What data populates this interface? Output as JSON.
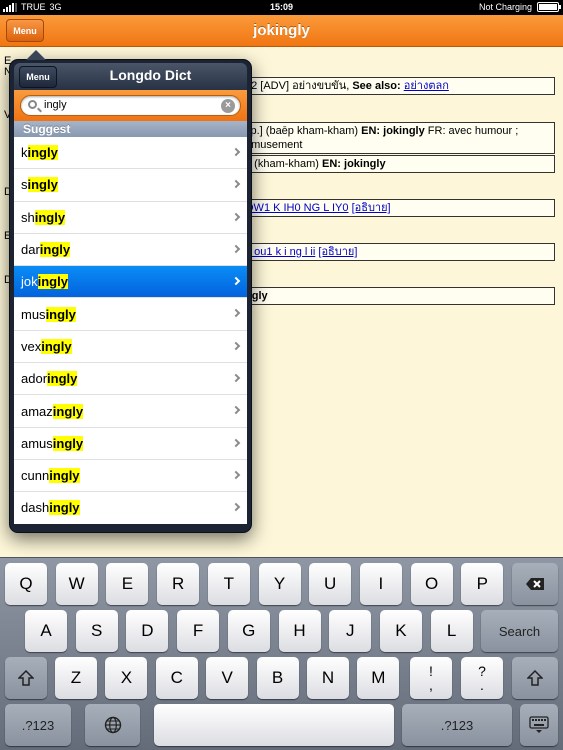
{
  "status_bar": {
    "carrier": "TRUE",
    "network": "3G",
    "time": "15:09",
    "battery_text": "Not Charging"
  },
  "navbar": {
    "title": "jokingly",
    "menu_label": "Menu"
  },
  "background": {
    "fragments": [
      "E",
      "N",
      "V",
      "D",
      "E",
      "D"
    ],
    "entries": [
      {
        "text": "u2 [ADV] อย่างขบขัน, ",
        "bold": "See also:",
        "link": "อย่างตลก"
      },
      {
        "text1": "xp.] (baēp kham-kham) ",
        "bold1": "EN: jokingly",
        "text2": "  FR: avec humour ;",
        "line2": "amusement"
      },
      {
        "text": ".] (kham-kham) ",
        "bold": "EN: jokingly"
      },
      {
        "link": "OW1 K IH0 NG L IY0",
        "link2": "[อธิบาย]"
      },
      {
        "link": "n ou1 k i ng l ii",
        "link2": "[อธิบาย]"
      },
      {
        "bold": "ngly"
      }
    ]
  },
  "popover": {
    "menu_label": "Menu",
    "title": "Longdo Dict",
    "search_value": "ingly",
    "section_header": "Suggest",
    "items": [
      {
        "pre": "k",
        "hl": "ingly"
      },
      {
        "pre": "s",
        "hl": "ingly"
      },
      {
        "pre": "sh",
        "hl": "ingly"
      },
      {
        "pre": "dar",
        "hl": "ingly"
      },
      {
        "pre": "jok",
        "hl": "ingly"
      },
      {
        "pre": "mus",
        "hl": "ingly"
      },
      {
        "pre": "vex",
        "hl": "ingly"
      },
      {
        "pre": "ador",
        "hl": "ingly"
      },
      {
        "pre": "amaz",
        "hl": "ingly"
      },
      {
        "pre": "amus",
        "hl": "ingly"
      },
      {
        "pre": "cunn",
        "hl": "ingly"
      },
      {
        "pre": "dash",
        "hl": "ingly"
      }
    ],
    "selected_index": 4
  },
  "keyboard": {
    "row1": [
      "Q",
      "W",
      "E",
      "R",
      "T",
      "Y",
      "U",
      "I",
      "O",
      "P"
    ],
    "row2": [
      "A",
      "S",
      "D",
      "F",
      "G",
      "H",
      "J",
      "K",
      "L"
    ],
    "row3": [
      "Z",
      "X",
      "C",
      "V",
      "B",
      "N",
      "M"
    ],
    "search_label": "Search",
    "numbers_label": ".?123",
    "excl_top": "!",
    "excl_bottom": ",",
    "quest_top": "?",
    "quest_bottom": "."
  },
  "icons": [
    "signal-icon",
    "battery-icon",
    "search-icon",
    "clear-icon",
    "chevron-right-icon",
    "backspace-icon",
    "shift-icon",
    "globe-icon",
    "keyboard-dismiss-icon"
  ]
}
